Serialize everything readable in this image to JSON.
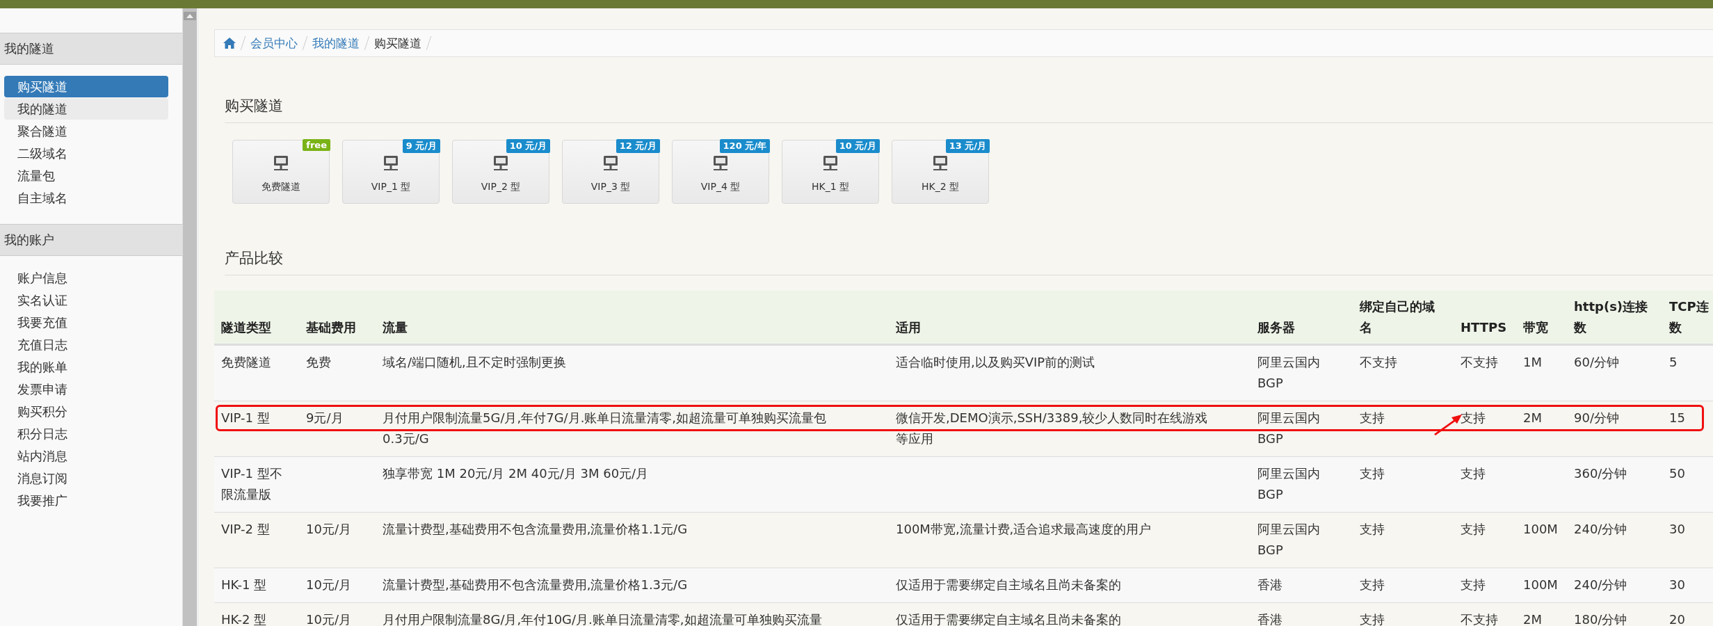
{
  "sidebar": {
    "sections": [
      {
        "title": "我的隧道",
        "items": [
          {
            "label": "购买隧道",
            "selected": true,
            "highlighted": false
          },
          {
            "label": "我的隧道",
            "selected": false,
            "highlighted": true
          },
          {
            "label": "聚合隧道",
            "selected": false,
            "highlighted": false
          },
          {
            "label": "二级域名",
            "selected": false,
            "highlighted": false
          },
          {
            "label": "流量包",
            "selected": false,
            "highlighted": false
          },
          {
            "label": "自主域名",
            "selected": false,
            "highlighted": false
          }
        ]
      },
      {
        "title": "我的账户",
        "items": [
          {
            "label": "账户信息",
            "selected": false,
            "highlighted": false
          },
          {
            "label": "实名认证",
            "selected": false,
            "highlighted": false
          },
          {
            "label": "我要充值",
            "selected": false,
            "highlighted": false
          },
          {
            "label": "充值日志",
            "selected": false,
            "highlighted": false
          },
          {
            "label": "我的账单",
            "selected": false,
            "highlighted": false
          },
          {
            "label": "发票申请",
            "selected": false,
            "highlighted": false
          },
          {
            "label": "购买积分",
            "selected": false,
            "highlighted": false
          },
          {
            "label": "积分日志",
            "selected": false,
            "highlighted": false
          },
          {
            "label": "站内消息",
            "selected": false,
            "highlighted": false
          },
          {
            "label": "消息订阅",
            "selected": false,
            "highlighted": false
          },
          {
            "label": "我要推广",
            "selected": false,
            "highlighted": false
          }
        ]
      }
    ]
  },
  "breadcrumb": [
    "会员中心",
    "我的隧道",
    "购买隧道"
  ],
  "buy_section": {
    "title": "购买隧道",
    "plans": [
      {
        "label": "免费隧道",
        "badge": "free",
        "color": "#7ab317"
      },
      {
        "label": "VIP_1 型",
        "badge": "9 元/月",
        "color": "#1a8ccc"
      },
      {
        "label": "VIP_2 型",
        "badge": "10 元/月",
        "color": "#1a8ccc"
      },
      {
        "label": "VIP_3 型",
        "badge": "12 元/月",
        "color": "#1a8ccc"
      },
      {
        "label": "VIP_4 型",
        "badge": "120 元/年",
        "color": "#1a8ccc"
      },
      {
        "label": "HK_1 型",
        "badge": "10 元/月",
        "color": "#1a8ccc"
      },
      {
        "label": "HK_2 型",
        "badge": "13 元/月",
        "color": "#1a8ccc"
      }
    ]
  },
  "compare_section": {
    "title": "产品比较",
    "table": {
      "columns": [
        "隧道类型",
        "基础费用",
        "流量",
        "适用",
        "服务器",
        "绑定自己的域名",
        "HTTPS",
        "带宽",
        "http(s)连接数",
        "TCP连数"
      ],
      "rows": [
        {
          "annotated": false,
          "cells": [
            "免费隧道",
            "免费",
            "域名/端口随机,且不定时强制更换",
            "适合临时使用,以及购买VIP前的测试",
            "阿里云国内\nBGP",
            "不支持",
            "不支持",
            "1M",
            "60/分钟",
            "5"
          ]
        },
        {
          "annotated": true,
          "cells": [
            "VIP-1 型",
            "9元/月",
            "月付用户限制流量5G/月,年付7G/月.账单日流量清零,如超流量可单独购买流量包\n0.3元/G",
            "微信开发,DEMO演示,SSH/3389,较少人数同时在线游戏等应用",
            "阿里云国内\nBGP",
            "支持",
            "支持",
            "2M",
            "90/分钟",
            "15"
          ]
        },
        {
          "annotated": false,
          "cells": [
            "VIP-1 型不限流量版",
            "",
            "独享带宽 1M 20元/月 2M 40元/月 3M 60元/月",
            "",
            "阿里云国内\nBGP",
            "支持",
            "支持",
            "",
            "360/分钟",
            "50"
          ]
        },
        {
          "annotated": false,
          "cells": [
            "VIP-2 型",
            "10元/月",
            "流量计费型,基础费用不包含流量费用,流量价格1.1元/G",
            "100M带宽,流量计费,适合追求最高速度的用户",
            "阿里云国内\nBGP",
            "支持",
            "支持",
            "100M",
            "240/分钟",
            "30"
          ]
        },
        {
          "annotated": false,
          "cells": [
            "HK-1 型",
            "10元/月",
            "流量计费型,基础费用不包含流量费用,流量价格1.3元/G",
            "仅适用于需要绑定自主域名且尚未备案的",
            "香港",
            "支持",
            "支持",
            "100M",
            "240/分钟",
            "30"
          ]
        },
        {
          "annotated": false,
          "cells": [
            "HK-2 型",
            "10元/月",
            "月付用户限制流量8G/月,年付10G/月.账单日流量清零,如超流量可单独购买流量",
            "仅适用于需要绑定自主域名且尚未备案的",
            "香港",
            "支持",
            "不支持",
            "2M",
            "180/分钟",
            "20"
          ]
        }
      ]
    }
  }
}
